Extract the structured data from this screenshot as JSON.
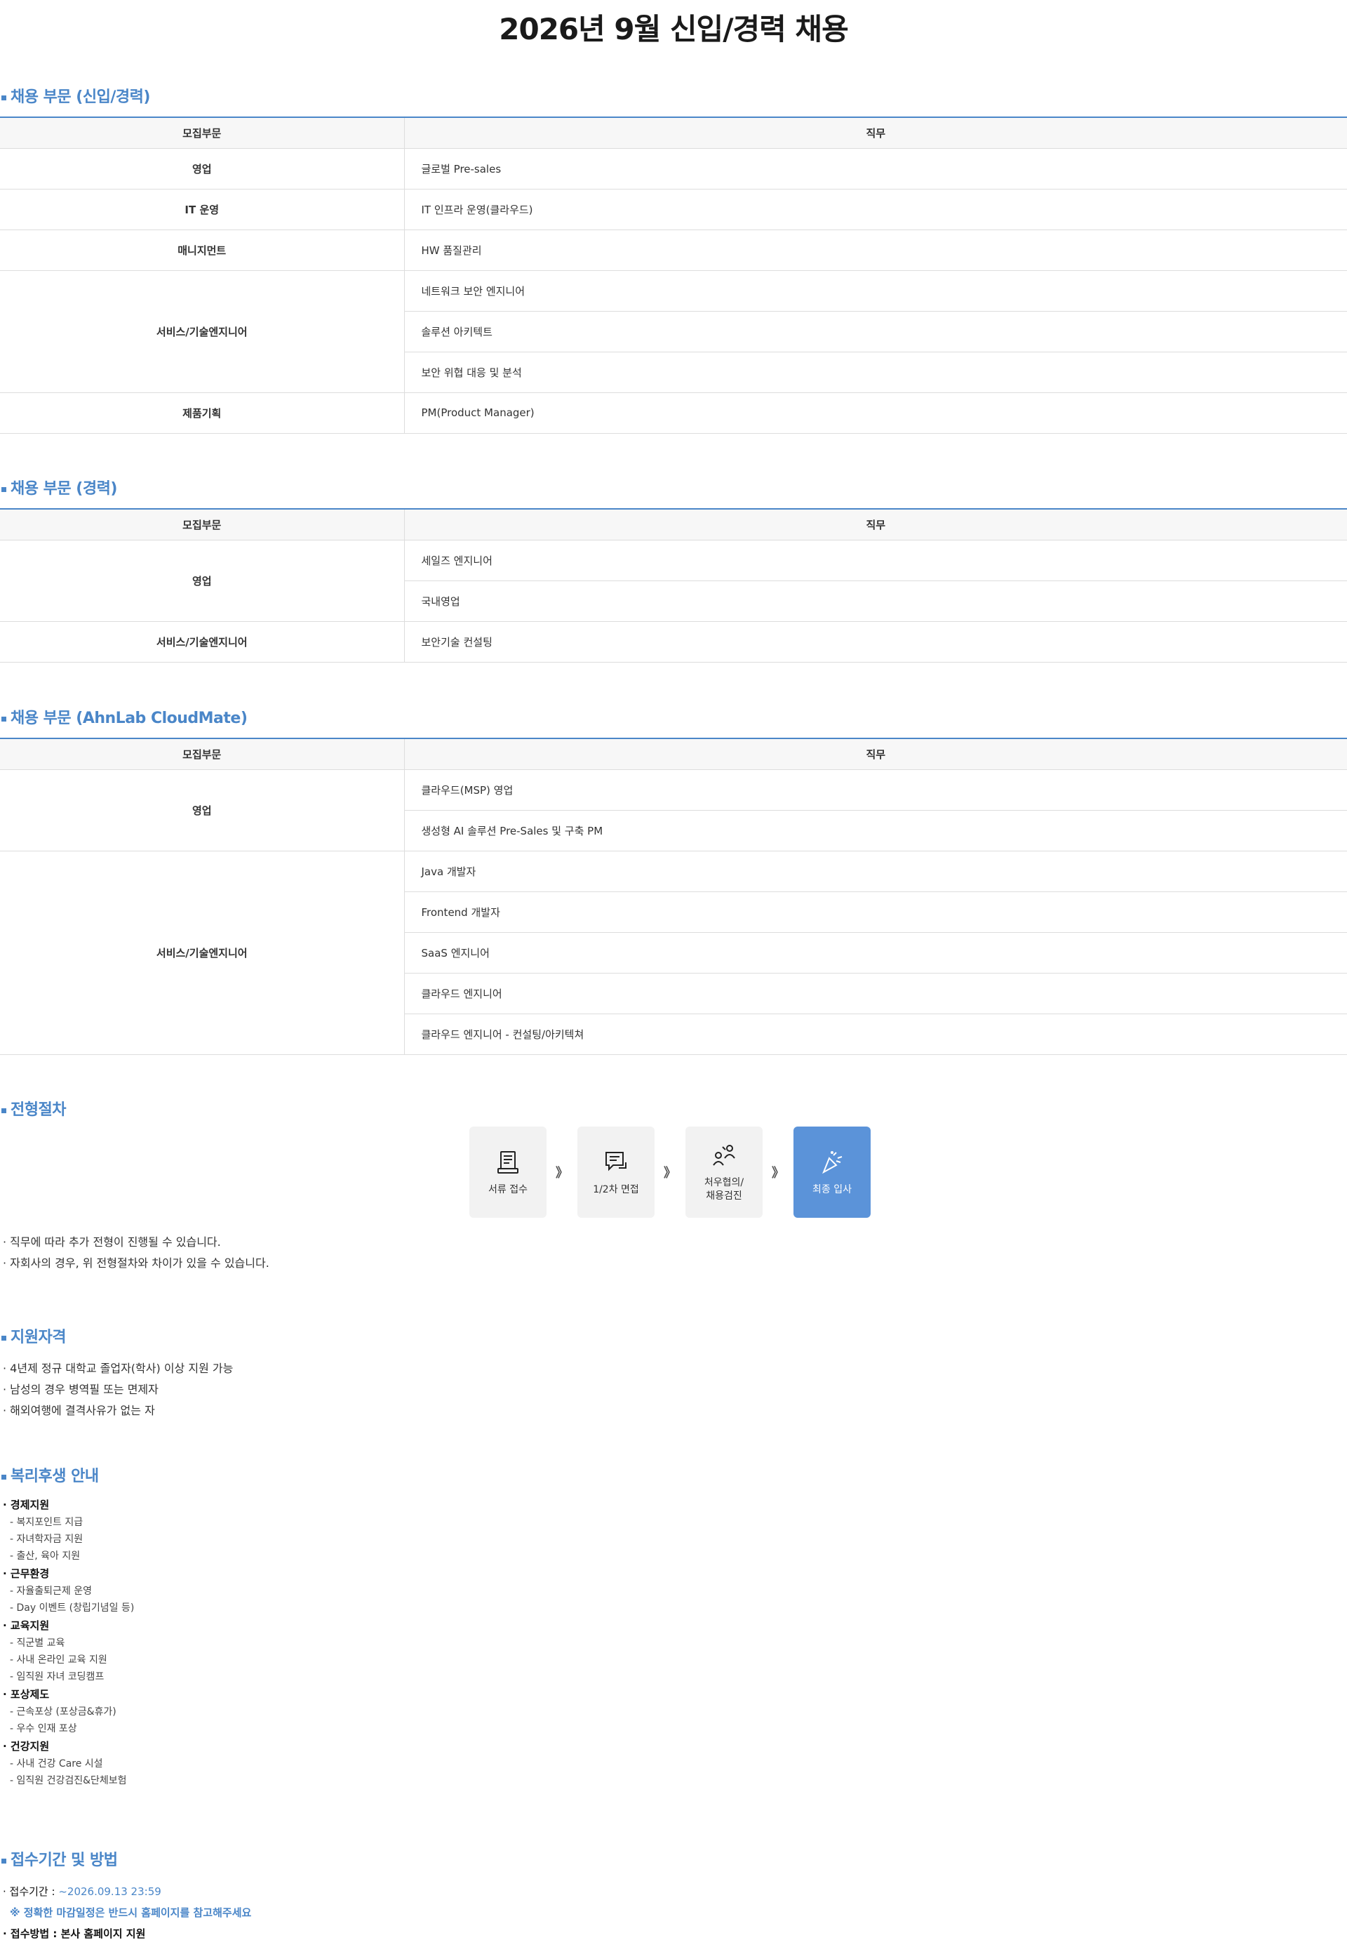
{
  "page_title": "2026년 9월 신입/경력 채용",
  "tables": [
    {
      "title": "채용 부문 (신입/경력)",
      "header": {
        "dept": "모집부문",
        "job": "직무"
      },
      "groups": [
        {
          "dept": "영업",
          "jobs": [
            "글로벌 Pre-sales"
          ]
        },
        {
          "dept": "IT 운영",
          "jobs": [
            "IT 인프라 운영(클라우드)"
          ]
        },
        {
          "dept": "매니지먼트",
          "jobs": [
            "HW 품질관리"
          ]
        },
        {
          "dept": "서비스/기술엔지니어",
          "jobs": [
            "네트워크 보안 엔지니어",
            "솔루션 아키텍트",
            "보안 위협 대응 및 분석"
          ]
        },
        {
          "dept": "제품기획",
          "jobs": [
            "PM(Product Manager)"
          ]
        }
      ]
    },
    {
      "title": "채용 부문 (경력)",
      "header": {
        "dept": "모집부문",
        "job": "직무"
      },
      "groups": [
        {
          "dept": "영업",
          "jobs": [
            "세일즈 엔지니어",
            "국내영업"
          ]
        },
        {
          "dept": "서비스/기술엔지니어",
          "jobs": [
            "보안기술 컨설팅"
          ]
        }
      ]
    },
    {
      "title": "채용 부문 (AhnLab CloudMate)",
      "header": {
        "dept": "모집부문",
        "job": "직무"
      },
      "groups": [
        {
          "dept": "영업",
          "jobs": [
            "클라우드(MSP) 영업",
            "생성형 AI 솔루션 Pre-Sales 및 구축 PM"
          ]
        },
        {
          "dept": "서비스/기술엔지니어",
          "jobs": [
            "Java 개발자",
            "Frontend 개발자",
            "SaaS 엔지니어",
            "클라우드 엔지니어",
            "클라우드 엔지니어 - 컨설팅/아키텍쳐"
          ]
        }
      ]
    }
  ],
  "process": {
    "title": "전형절차",
    "steps": [
      {
        "label": "서류 접수",
        "icon": "document-icon"
      },
      {
        "label": "1/2차 면접",
        "icon": "interview-chat-icon"
      },
      {
        "label": "처우협의/\n채용검진",
        "icon": "negotiation-icon"
      },
      {
        "label": "최종 입사",
        "icon": "celebration-icon"
      }
    ],
    "arrow": "》",
    "notes": [
      "· 직무에 따라 추가 전형이 진행될 수 있습니다.",
      "· 자회사의 경우, 위 전형절차와 차이가 있을 수 있습니다."
    ]
  },
  "qualifications": {
    "title": "지원자격",
    "items": [
      "· 4년제 정규 대학교 졸업자(학사) 이상 지원 가능",
      "· 남성의 경우 병역필 또는 면제자",
      "· 해외여행에 결격사유가 없는 자"
    ]
  },
  "benefits": {
    "title": "복리후생 안내",
    "categories": [
      {
        "name": "· 경제지원",
        "items": [
          "- 복지포인트 지급",
          "- 자녀학자금 지원",
          "- 출산, 육아 지원"
        ]
      },
      {
        "name": "· 근무환경",
        "items": [
          "- 자율출퇴근제 운영",
          "- Day 이벤트 (창립기념일 등)"
        ]
      },
      {
        "name": "· 교육지원",
        "items": [
          "- 직군별 교육",
          "- 사내 온라인 교육 지원",
          "- 임직원 자녀 코딩캠프"
        ]
      },
      {
        "name": "· 포상제도",
        "items": [
          "- 근속포상 (포상금&휴가)",
          "- 우수 인재 포상"
        ]
      },
      {
        "name": "· 건강지원",
        "items": [
          "- 사내 건강 Care 시설",
          "- 임직원 건강검진&단체보험"
        ]
      }
    ]
  },
  "application": {
    "title": "접수기간 및 방법",
    "period_label": "· 접수기간 : ",
    "period_value": "~2026.09.13 23:59",
    "warning": "※ 정확한 마감일정은 반드시 홈페이지를 참고해주세요",
    "method": "· 접수방법 : 본사 홈페이지 지원"
  },
  "colors": {
    "accent": "#4a86c8",
    "final_step": "#5b93d9"
  }
}
